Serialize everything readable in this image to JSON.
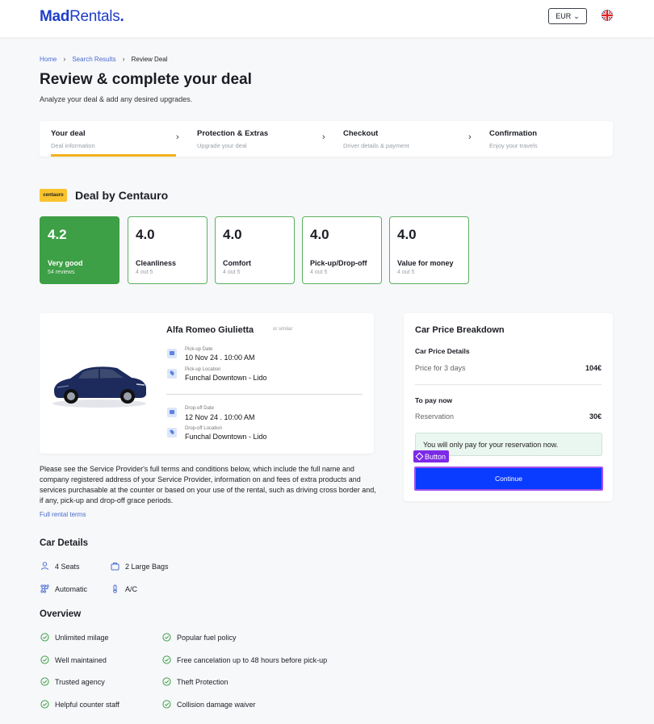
{
  "header": {
    "logo_part1": "Mad",
    "logo_part2": "Rentals",
    "logo_dot": ".",
    "currency": "EUR",
    "currency_chevron": "⌄"
  },
  "breadcrumb": {
    "items": [
      "Home",
      "Search Results",
      "Review Deal"
    ],
    "separator": "›"
  },
  "page": {
    "title": "Review & complete your deal",
    "subtitle": "Analyze your deal & add any desired upgrades."
  },
  "stepper": [
    {
      "title": "Your deal",
      "desc": "Deal information"
    },
    {
      "title": "Protection & Extras",
      "desc": "Upgrade your deal"
    },
    {
      "title": "Checkout",
      "desc": "Driver details & payment"
    },
    {
      "title": "Confirmation",
      "desc": "Enjoy your travels"
    }
  ],
  "stepper_arrow": "›",
  "deal": {
    "supplier_logo_text": "centauro",
    "title": "Deal by Centauro"
  },
  "ratings": [
    {
      "value": "4.2",
      "label": "Very good",
      "sub": "54 reviews"
    },
    {
      "value": "4.0",
      "label": "Cleanliness",
      "sub": "4 out 5"
    },
    {
      "value": "4.0",
      "label": "Comfort",
      "sub": "4 out 5"
    },
    {
      "value": "4.0",
      "label": "Pick-up/Drop-off",
      "sub": "4 out 5"
    },
    {
      "value": "4.0",
      "label": "Value for money",
      "sub": "4 out 5"
    }
  ],
  "car": {
    "name": "Alfa Romeo Giulietta",
    "similar": "or similar",
    "pickup_date_label": "Pick-up Date",
    "pickup_date": "10 Nov 24 . 10:00 AM",
    "pickup_loc_label": "Pick-up Location",
    "pickup_loc": "Funchal Downtown - Lido",
    "dropoff_date_label": "Drop-off Date",
    "dropoff_date": "12 Nov 24 . 10:00 AM",
    "dropoff_loc_label": "Drop-off Location",
    "dropoff_loc": "Funchal Downtown - Lido"
  },
  "terms": {
    "text": "Please see the Service Provider's full terms and conditions below, which include the full name and company registered address of your Service Provider, information on and fees of extra products and services purchasable at the counter or based on your use of the rental, such as driving cross border and, if any, pick-up and drop-off grace periods.",
    "link": "Full rental terms"
  },
  "price": {
    "title": "Car Price Breakdown",
    "details_title": "Car Price Details",
    "price_label": "Price for 3 days",
    "price_value": "104€",
    "pay_now_title": "To pay now",
    "reservation_label": "Reservation",
    "reservation_value": "30€",
    "notice": "You will only pay for your reservation now.",
    "tag_label": "Button",
    "continue_label": "Continue"
  },
  "car_details": {
    "title": "Car Details",
    "items": [
      "4 Seats",
      "2 Large Bags",
      "Automatic",
      "A/C"
    ]
  },
  "overview": {
    "title": "Overview",
    "left": [
      "Unlimited milage",
      "Well maintained",
      "Trusted agency",
      "Helpful counter staff"
    ],
    "right": [
      "Popular fuel policy",
      "Free cancelation up to 48 hours before pick-up",
      "Theft Protection",
      "Collision damage waiver"
    ]
  },
  "colors": {
    "brand": "#1f3ec8",
    "rating_green": "#3d9f46",
    "accent_yellow": "#f2b21d",
    "continue_blue": "#0a3cff"
  }
}
